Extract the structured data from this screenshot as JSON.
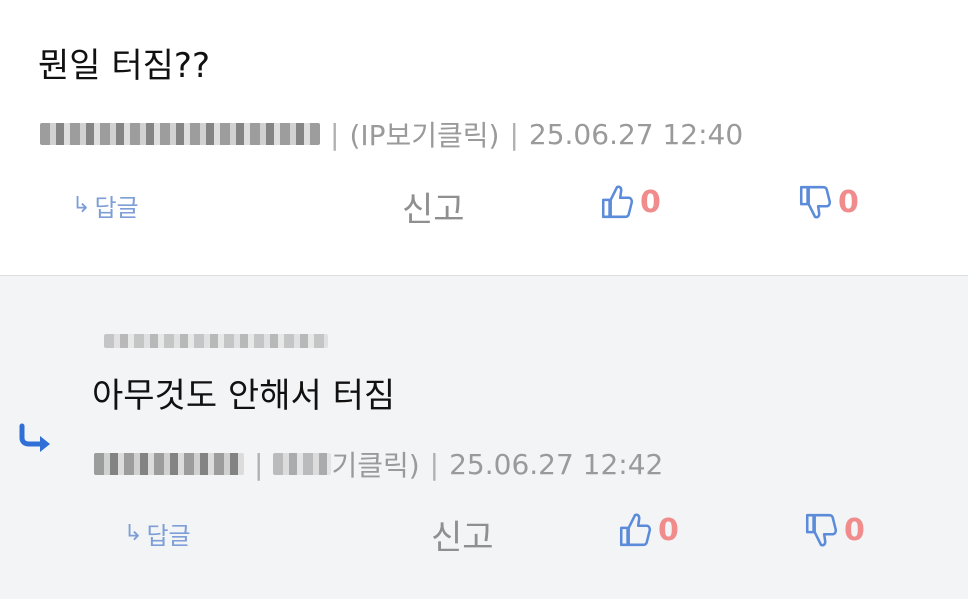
{
  "comments": [
    {
      "body": "뭔일 터짐??",
      "ip_label": "(IP보기클릭)",
      "datetime": "25.06.27 12:40",
      "reply_label": "답글",
      "report_label": "신고",
      "likes": "0",
      "dislikes": "0"
    },
    {
      "body": "아무것도 안해서 터짐",
      "ip_label": "기클릭)",
      "datetime": "25.06.27 12:42",
      "reply_label": "답글",
      "report_label": "신고",
      "likes": "0",
      "dislikes": "0"
    }
  ],
  "icons": {
    "reply_small": "reply-arrow-icon",
    "like": "thumbs-up-icon",
    "dislike": "thumbs-down-icon",
    "nested_reply": "nested-reply-arrow-icon"
  },
  "colors": {
    "count": "#f08c8c",
    "icon_blue": "#5b8bd9",
    "reply_arrow": "#2f6fd6",
    "reply_bg": "#f3f4f6"
  }
}
